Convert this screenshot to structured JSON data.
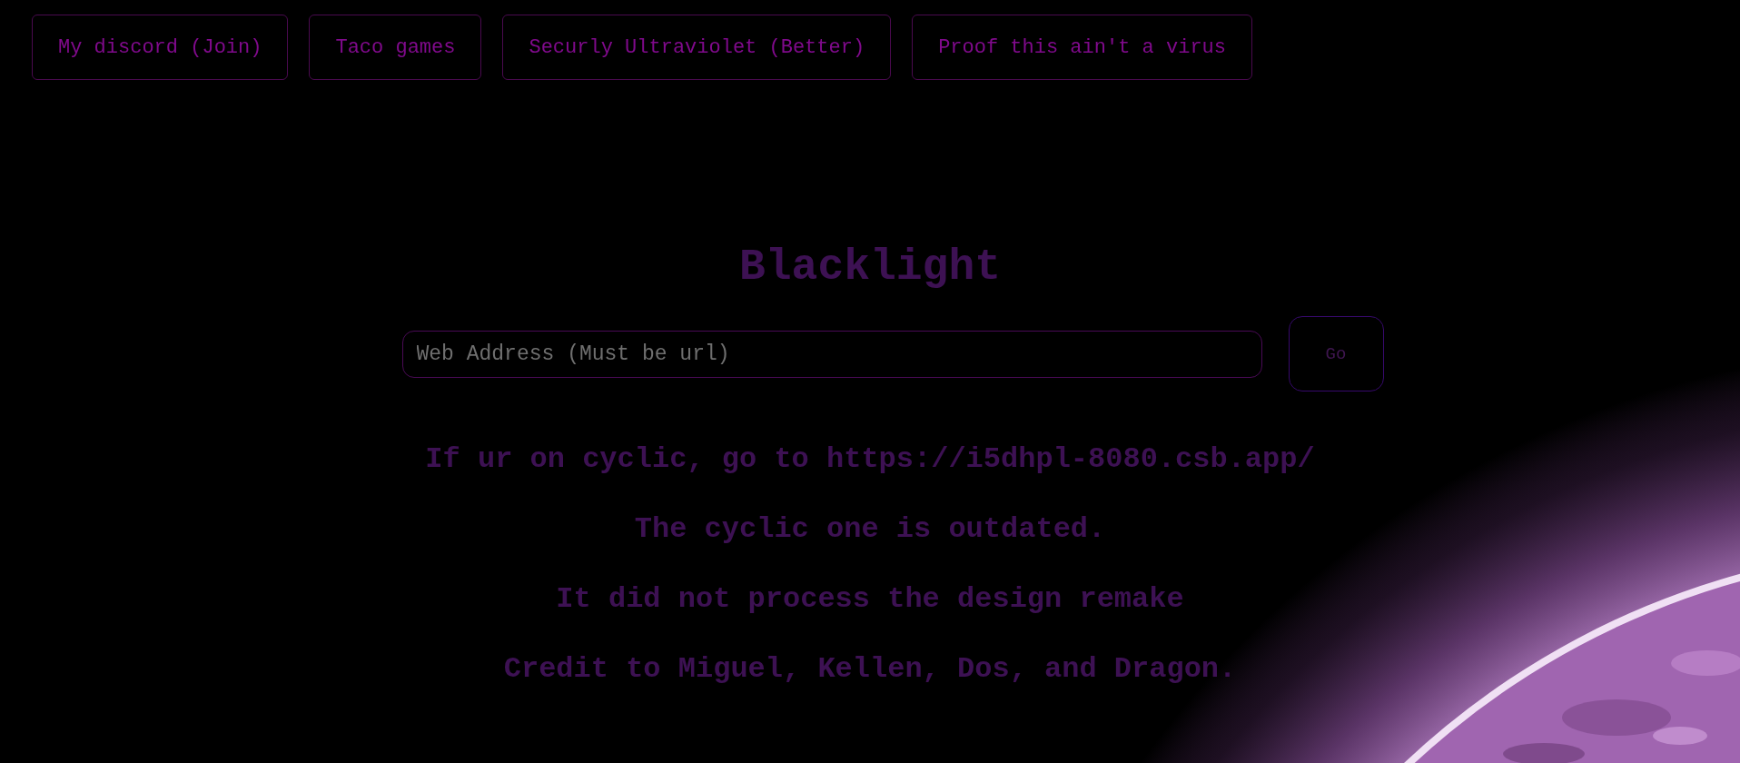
{
  "nav_links": [
    "My discord (Join)",
    "Taco games",
    "Securly Ultraviolet (Better)",
    "Proof this ain't a virus"
  ],
  "title": "Blacklight",
  "search": {
    "placeholder": "Web Address (Must be url)"
  },
  "go_button": "Go",
  "messages": [
    "If ur on cyclic, go to https://i5dhpl-8080.csb.app/",
    "The cyclic one is outdated.",
    "It did not process the design remake",
    "Credit to Miguel, Kellen, Dos, and Dragon."
  ]
}
